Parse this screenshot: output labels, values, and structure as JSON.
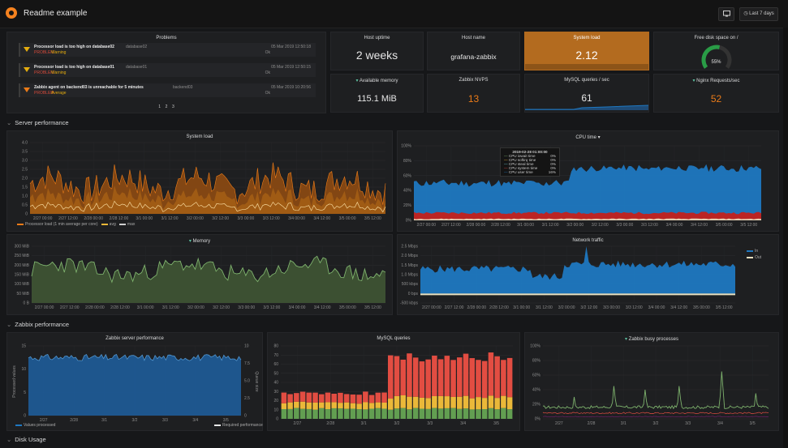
{
  "header": {
    "title": "Readme example",
    "time_range": "Last 7 days",
    "tv_icon": "monitor-icon",
    "clock_icon": "clock-icon"
  },
  "colors": {
    "background": "#161719",
    "panel": "#1e1f21",
    "orange": "#eb7b18",
    "green": "#7eb26d",
    "blue": "#1f78c1",
    "red": "#e24d42",
    "yellow": "#eab839",
    "statbg_orange": "#b36b1f"
  },
  "problems": {
    "title": "Problems",
    "items": [
      {
        "text": "Processor load is too high on database02",
        "host": "database02",
        "severity_label": "PROBLEM",
        "severity": "Warning",
        "time": "05 Mar 2019 12:50:18",
        "ack": "Ok"
      },
      {
        "text": "Processor load is too high on database01",
        "host": "database01",
        "severity_label": "PROBLEM",
        "severity": "Warning",
        "time": "05 Mar 2019 12:50:15",
        "ack": "Ok"
      },
      {
        "text": "Zabbix agent on backend03 is unreachable for 5 minutes",
        "host": "backend03",
        "severity_label": "PROBLEM",
        "severity": "Average",
        "time": "05 Mar 2019 10:20:56",
        "ack": "Ok"
      }
    ],
    "pages": [
      "1",
      "2",
      "3"
    ]
  },
  "stats": {
    "uptime": {
      "title": "Host uptime",
      "value": "2 weeks"
    },
    "hostname": {
      "title": "Host name",
      "value": "grafana-zabbix"
    },
    "sysload": {
      "title": "System load",
      "value": "2.12"
    },
    "freedisk": {
      "title": "Free disk space on /",
      "value": "55%",
      "gauge": 0.55
    },
    "memory": {
      "title": "Available memory",
      "value": "115.1 MiB"
    },
    "nvps": {
      "title": "Zabbix NVPS",
      "value": "13"
    },
    "mysql": {
      "title": "MySQL queries / sec",
      "value": "61"
    },
    "nginx": {
      "title": "Nginx Requests/sec",
      "value": "52"
    }
  },
  "rows": {
    "server": "Server performance",
    "zabbix": "Zabbix performance",
    "disk": "Disk Usage"
  },
  "sysload_panel": {
    "title": "System load",
    "legend": [
      "Processor load (1 min average per core)",
      "avg",
      "max"
    ]
  },
  "cpu_panel": {
    "title": "CPU time",
    "tooltip_time": "2019-02-28 01:00:00",
    "tooltip": [
      {
        "name": "CPU iowait time",
        "value": "0%"
      },
      {
        "name": "CPU softirq time",
        "value": "0%"
      },
      {
        "name": "CPU steal time",
        "value": "0%"
      },
      {
        "name": "CPU system time",
        "value": "0%"
      },
      {
        "name": "CPU user time",
        "value": "16%"
      }
    ]
  },
  "memory_panel": {
    "title": "Memory"
  },
  "network_panel": {
    "title": "Network traffic",
    "legend": [
      "In",
      "Out"
    ]
  },
  "zabbix_server_panel": {
    "title": "Zabbix server performance",
    "ylabel": "Processed values",
    "ylabel_right": "Queue size",
    "legend": [
      "Values processed",
      "Required performance"
    ]
  },
  "mysql_panel": {
    "title": "MySQL queries"
  },
  "busy_panel": {
    "title": "Zabbix busy processes"
  },
  "axes": {
    "sysload_x": [
      "2/27 00:00",
      "2/27 12:00",
      "2/28 00:00",
      "2/28 12:00",
      "3/1 00:00",
      "3/1 12:00",
      "3/2 00:00",
      "3/2 12:00",
      "3/3 00:00",
      "3/3 12:00",
      "3/4 00:00",
      "3/4 12:00",
      "3/5 00:00",
      "3/5 12:00"
    ],
    "sysload_y": [
      "0",
      "0.5",
      "1.0",
      "1.5",
      "2.0",
      "2.5",
      "3.0",
      "3.5",
      "4.0"
    ],
    "cpu_x": [
      "2/27 00:00",
      "2/27 12:00",
      "2/28 00:00",
      "2/28 12:00",
      "3/1 00:00",
      "3/1 12:00",
      "3/2 00:00",
      "3/2 12:00",
      "3/3 00:00",
      "3/3 12:00",
      "3/4 00:00",
      "3/4 12:00",
      "3/5 00:00",
      "3/5 12:00"
    ],
    "cpu_y": [
      "0%",
      "20%",
      "40%",
      "60%",
      "80%",
      "100%"
    ],
    "mem_x": [
      "2/27 00:00",
      "2/27 12:00",
      "2/28 00:00",
      "2/28 12:00",
      "3/1 00:00",
      "3/1 12:00",
      "3/2 00:00",
      "3/2 12:00",
      "3/3 00:00",
      "3/3 12:00",
      "3/4 00:00",
      "3/4 12:00",
      "3/5 00:00",
      "3/5 12:00"
    ],
    "mem_y": [
      "0 B",
      "50 MiB",
      "100 MiB",
      "150 MiB",
      "200 MiB",
      "250 MiB",
      "300 MiB"
    ],
    "net_x": [
      "2/27 00:00",
      "2/27 12:00",
      "2/28 00:00",
      "2/28 12:00",
      "3/1 00:00",
      "3/1 12:00",
      "3/2 00:00",
      "3/2 12:00",
      "3/3 00:00",
      "3/3 12:00",
      "3/4 00:00",
      "3/4 12:00",
      "3/5 00:00",
      "3/5 12:00"
    ],
    "net_y": [
      "-500 kbps",
      "0 bps",
      "500 kbps",
      "1.0 Mbps",
      "1.5 Mbps",
      "2.0 Mbps",
      "2.5 Mbps"
    ],
    "zs_x": [
      "2/27",
      "2/28",
      "3/1",
      "3/2",
      "3/3",
      "3/4",
      "3/5"
    ],
    "zs_y": [
      "0",
      "5",
      "10",
      "15"
    ],
    "zs_y2": [
      "0",
      "2.5",
      "5.0",
      "7.5",
      "10"
    ],
    "mysql_x": [
      "2/27",
      "2/28",
      "3/1",
      "3/2",
      "3/3",
      "3/4",
      "3/5"
    ],
    "mysql_y": [
      "0",
      "10",
      "20",
      "30",
      "40",
      "50",
      "60",
      "70",
      "80"
    ],
    "busy_x": [
      "2/27",
      "2/28",
      "3/1",
      "3/2",
      "3/3",
      "3/4",
      "3/5"
    ],
    "busy_y": [
      "0%",
      "20%",
      "40%",
      "60%",
      "80%",
      "100%"
    ]
  }
}
